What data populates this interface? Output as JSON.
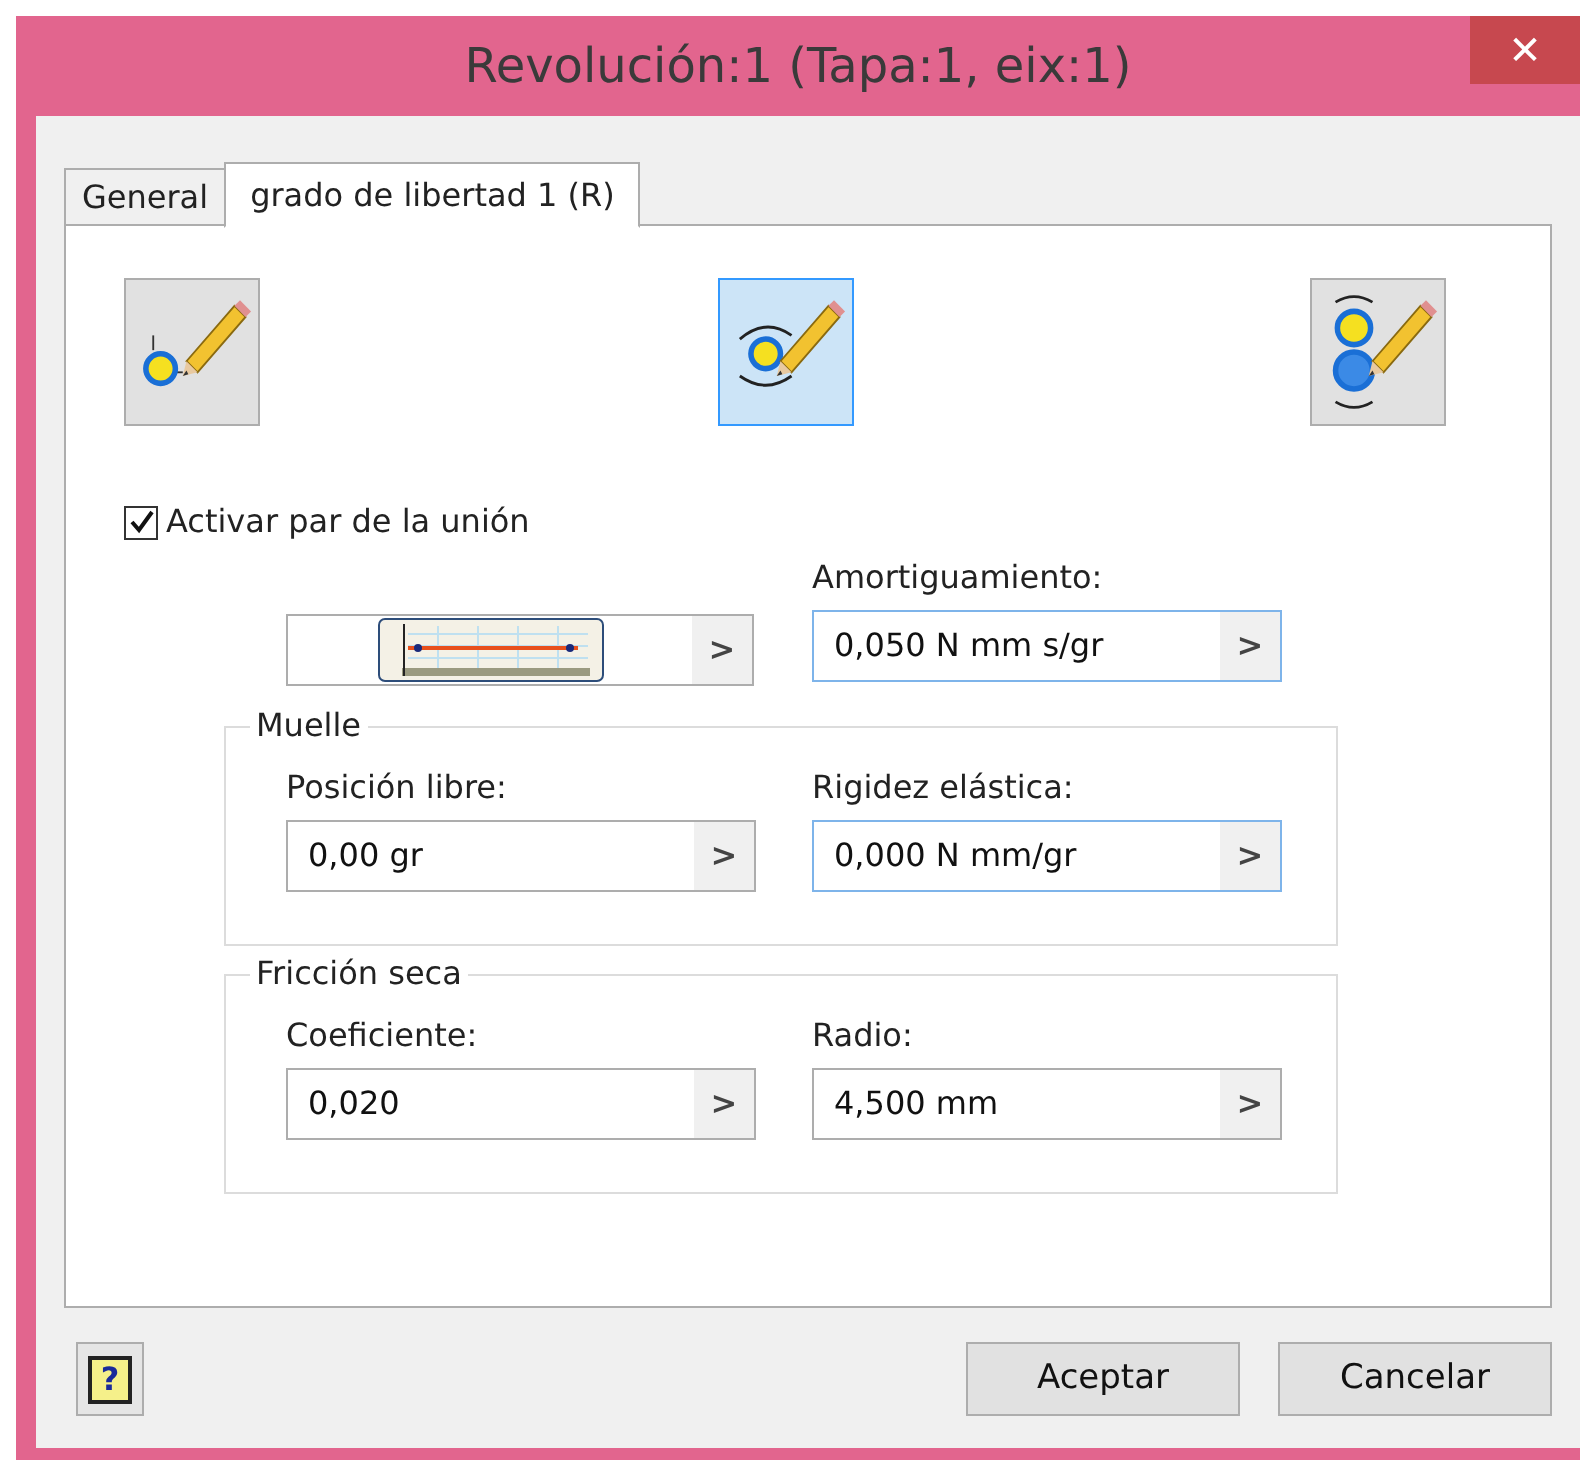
{
  "window": {
    "title": "Revolución:1 (Tapa:1, eix:1)",
    "close": "✕"
  },
  "tabs": [
    {
      "label": "General",
      "selected": false
    },
    {
      "label": "grado de libertad 1 (R)",
      "selected": true
    }
  ],
  "tool_buttons": [
    {
      "kind": "point",
      "selected": false
    },
    {
      "kind": "rotation",
      "selected": true
    },
    {
      "kind": "pair",
      "selected": false
    }
  ],
  "torque": {
    "label": "Activar par de la unión",
    "checked": true,
    "graph_field": {
      "arrow": ">"
    }
  },
  "damping": {
    "label": "Amortiguamiento:",
    "value": "0,050 N mm s/gr",
    "arrow": ">",
    "highlighted": true
  },
  "groups": [
    {
      "title": "Muelle",
      "fields": [
        {
          "label": "Posición libre:",
          "value": "0,00 gr",
          "arrow": ">",
          "highlighted": false
        },
        {
          "label": "Rigidez elástica:",
          "value": "0,000 N mm/gr",
          "arrow": ">",
          "highlighted": true
        }
      ]
    },
    {
      "title": "Fricción seca",
      "fields": [
        {
          "label": "Coeficiente:",
          "value": "0,020",
          "arrow": ">",
          "highlighted": false
        },
        {
          "label": "Radio:",
          "value": "4,500 mm",
          "arrow": ">",
          "highlighted": false
        }
      ]
    }
  ],
  "buttons": [
    "Aceptar",
    "Cancelar"
  ],
  "help": "?"
}
